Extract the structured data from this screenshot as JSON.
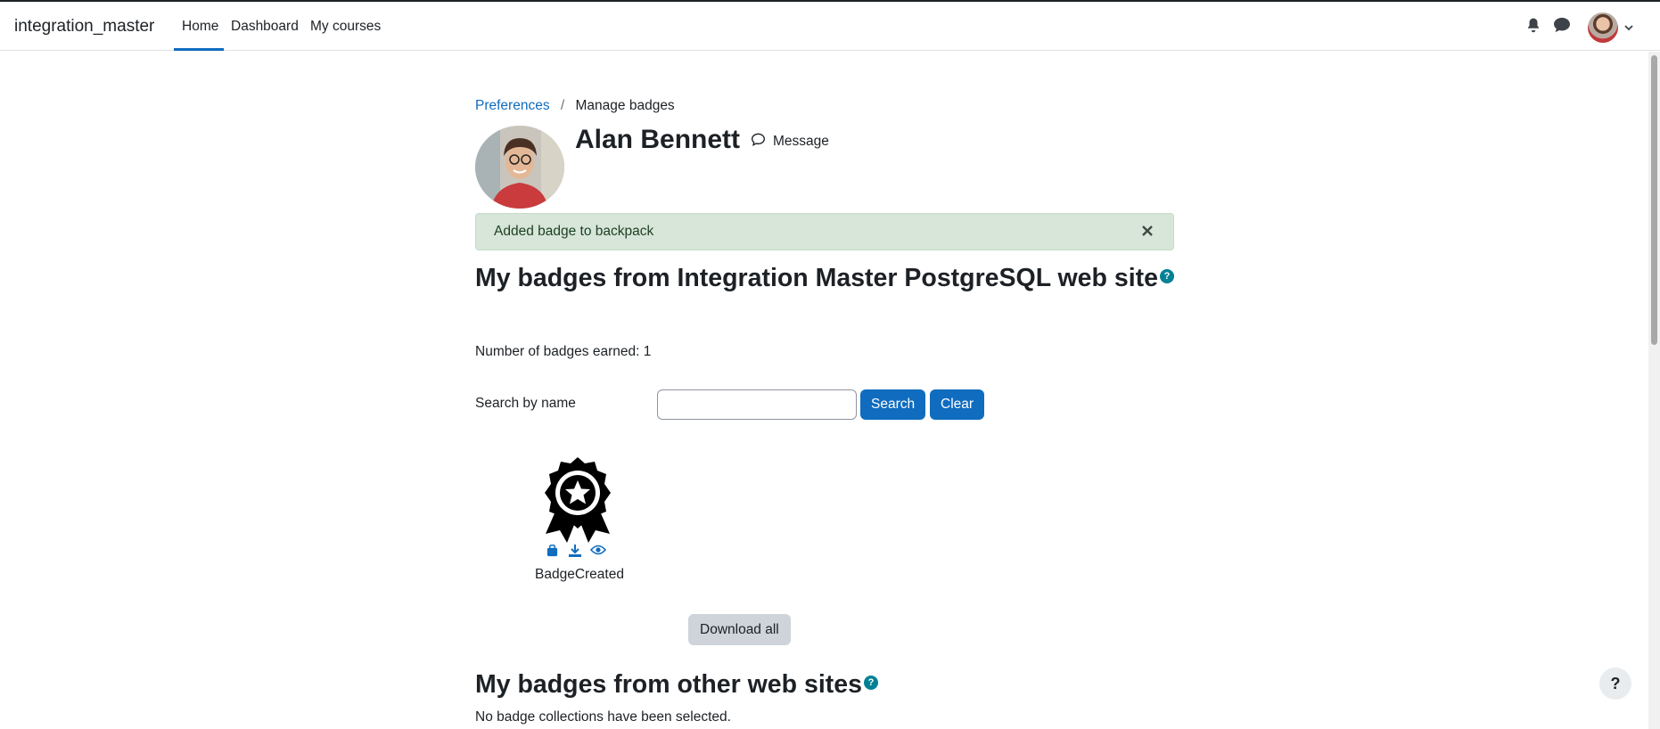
{
  "nav": {
    "brand": "integration_master",
    "links": [
      "Home",
      "Dashboard",
      "My courses"
    ],
    "active": "Home"
  },
  "breadcrumb": {
    "items": [
      "Preferences",
      "Manage badges"
    ]
  },
  "profile": {
    "name": "Alan Bennett",
    "message_label": "Message"
  },
  "alert": {
    "text": "Added badge to backpack"
  },
  "main": {
    "heading": "My badges from Integration Master PostgreSQL web site",
    "badge_count": "Number of badges earned: 1",
    "search_label": "Search by name",
    "search_value": "",
    "search_button": "Search",
    "clear_button": "Clear",
    "badge_name": "BadgeCreated",
    "download_all": "Download all"
  },
  "other": {
    "heading": "My badges from other web sites",
    "empty_text": "No badge collections have been selected."
  },
  "help_fab": "?",
  "help_icon": "?",
  "colors": {
    "primary": "#0f6cbf",
    "alert_bg": "#d7e6d9",
    "help": "#008196",
    "secondary_btn": "#ced4da"
  }
}
